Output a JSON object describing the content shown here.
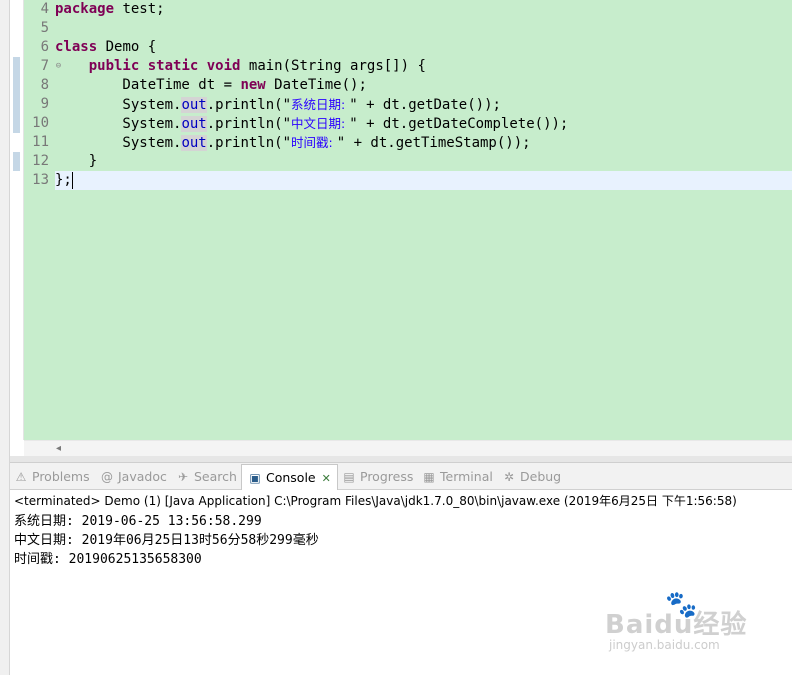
{
  "editor": {
    "line_numbers": [
      "4",
      "5",
      "6",
      "7",
      "8",
      "9",
      "10",
      "11",
      "12",
      "13"
    ],
    "code": {
      "l4_kw": "package",
      "l4_rest": " test;",
      "l6_kw": "class",
      "l6_rest": " Demo {",
      "l7_indent": "    ",
      "l7_kw1": "public",
      "l7_kw2": "static",
      "l7_kw3": "void",
      "l7_rest": " main(String args[]) {",
      "l8_a": "        DateTime dt = ",
      "l8_kw": "new",
      "l8_b": " DateTime();",
      "l9_a": "        System.",
      "l9_field": "out",
      "l9_b": ".println(\"",
      "l9_str": "系统日期: ",
      "l9_c": "\" + dt.getDate());",
      "l10_a": "        System.",
      "l10_field": "out",
      "l10_b": ".println(\"",
      "l10_str": "中文日期: ",
      "l10_c": "\" + dt.getDateComplete());",
      "l11_a": "        System.",
      "l11_field": "out",
      "l11_b": ".println(\"",
      "l11_str": "时间戳: ",
      "l11_c": "\" + dt.getTimeStamp());",
      "l12": "    }",
      "l13": "};"
    },
    "fold_icon": "minus-fold-icon",
    "colors": {
      "background": "#c7edcc",
      "keyword": "#7f0055",
      "string": "#2a00ff",
      "field": "#0000c0"
    }
  },
  "views": {
    "tabs": [
      {
        "label": "Problems",
        "icon": "problems-icon",
        "glyph": "⚠"
      },
      {
        "label": "Javadoc",
        "icon": "javadoc-icon",
        "glyph": "@"
      },
      {
        "label": "Search",
        "icon": "search-icon",
        "glyph": "✈"
      },
      {
        "label": "Console",
        "icon": "console-icon",
        "glyph": "▣",
        "active": true
      },
      {
        "label": "Progress",
        "icon": "progress-icon",
        "glyph": "▤"
      },
      {
        "label": "Terminal",
        "icon": "terminal-icon",
        "glyph": "▦"
      },
      {
        "label": "Debug",
        "icon": "debug-icon",
        "glyph": "✲"
      }
    ],
    "close_glyph": "✕"
  },
  "console": {
    "status": "<terminated> Demo (1) [Java Application] C:\\Program Files\\Java\\jdk1.7.0_80\\bin\\javaw.exe (2019年6月25日 下午1:56:58)",
    "output": [
      "系统日期: 2019-06-25 13:56:58.299",
      "中文日期: 2019年06月25日13时56分58秒299毫秒",
      "时间戳: 20190625135658300"
    ]
  },
  "watermark": {
    "brand": "Baidu经验",
    "url": "jingyan.baidu.com"
  }
}
